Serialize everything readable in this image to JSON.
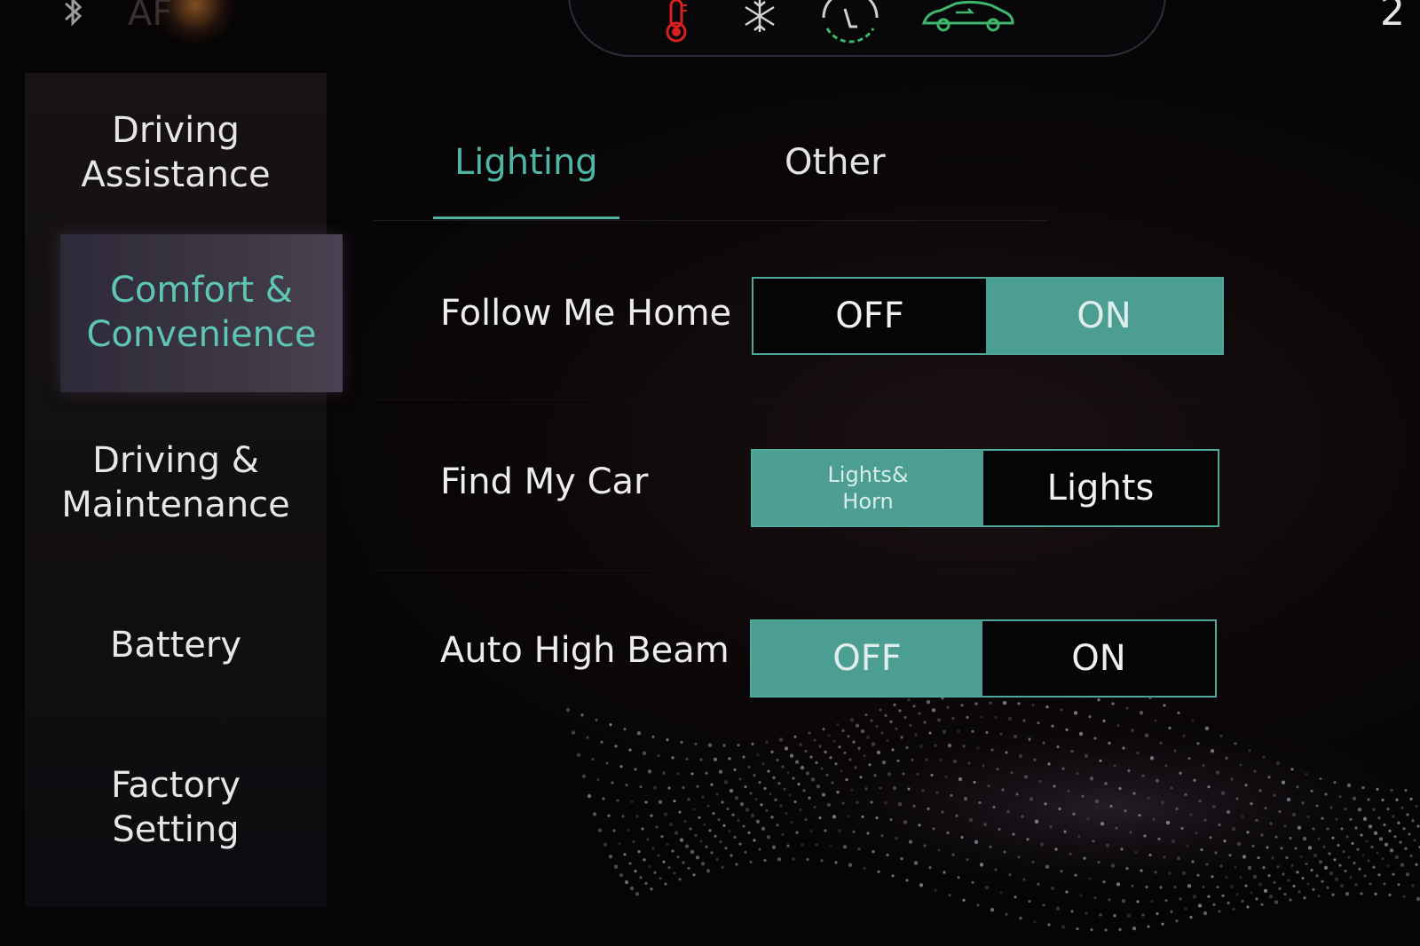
{
  "status_bar": {
    "left_text": "AF",
    "time_text": "2",
    "icons": [
      "bluetooth-icon",
      "temperature-icon",
      "snowflake-icon",
      "seat-heat-icon",
      "car-airflow-icon"
    ]
  },
  "sidebar": {
    "items": [
      {
        "label": "Driving\nAssistance",
        "active": false
      },
      {
        "label": "Comfort &\nConvenience",
        "active": true
      },
      {
        "label": "Driving &\nMaintenance",
        "active": false
      },
      {
        "label": "Battery",
        "active": false
      },
      {
        "label": "Factory\nSetting",
        "active": false
      }
    ]
  },
  "tabs": [
    {
      "label": "Lighting",
      "active": true
    },
    {
      "label": "Other",
      "active": false
    }
  ],
  "settings": [
    {
      "label": "Follow Me Home",
      "options": [
        "OFF",
        "ON"
      ],
      "selected": "ON"
    },
    {
      "label": "Find My Car",
      "options": [
        "Lights&\nHorn",
        "Lights"
      ],
      "selected": "Lights&\nHorn"
    },
    {
      "label": "Auto High Beam",
      "options": [
        "OFF",
        "ON"
      ],
      "selected": "OFF"
    }
  ],
  "colors": {
    "accent": "#4fb5a5",
    "selected_segment": "#4c9e93",
    "temperature_icon": "#d8201f",
    "airflow_icon": "#3fb56a"
  }
}
